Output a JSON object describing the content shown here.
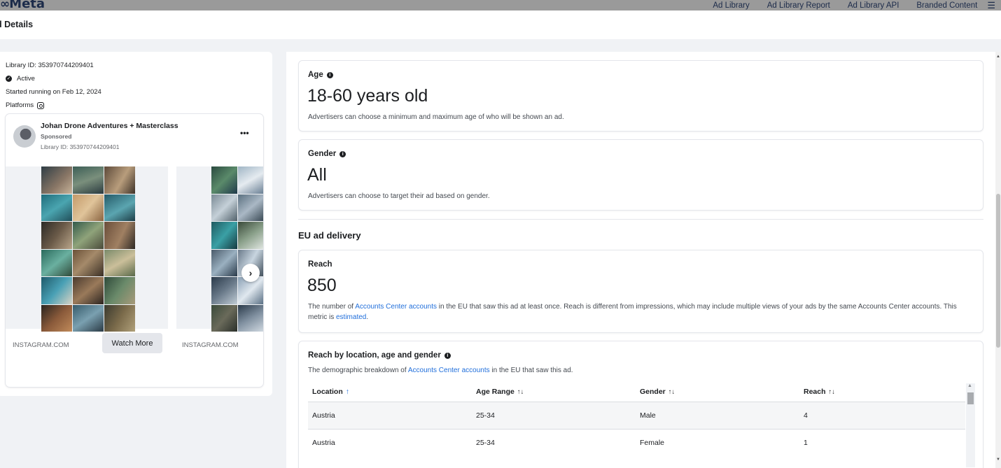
{
  "nav": {
    "logo_mark": "∞",
    "logo_text": "Meta",
    "links": [
      "Ad Library",
      "Ad Library Report",
      "Ad Library API",
      "Branded Content"
    ],
    "menu_icon": "☰"
  },
  "header": {
    "title": "d Details"
  },
  "ad_meta": {
    "library_id": "Library ID: 353970744209401",
    "status": "Active",
    "started": "Started running on Feb 12, 2024",
    "platforms_label": "Platforms",
    "platform_icon": "instagram-icon"
  },
  "ad_preview": {
    "advertiser": "Johan Drone Adventures + Masterclass",
    "sponsored": "Sponsored",
    "library_id": "Library ID: 353970744209401",
    "more": "•••",
    "next": "›",
    "cards": [
      {
        "domain": "INSTAGRAM.COM",
        "cta": "Watch More"
      },
      {
        "domain": "INSTAGRAM.COM"
      }
    ]
  },
  "age": {
    "label": "Age",
    "value": "18-60 years old",
    "description": "Advertisers can choose a minimum and maximum age of who will be shown an ad."
  },
  "gender": {
    "label": "Gender",
    "value": "All",
    "description": "Advertisers can choose to target their ad based on gender."
  },
  "eu_delivery": {
    "title": "EU ad delivery",
    "reach": {
      "label": "Reach",
      "value": "850",
      "desc_pre": "The number of ",
      "desc_link": "Accounts Center accounts",
      "desc_mid": " in the EU that saw this ad at least once. Reach is different from impressions, which may include multiple views of your ads by the same Accounts Center accounts. This metric is ",
      "desc_link2": "estimated",
      "desc_post": "."
    },
    "breakdown": {
      "label": "Reach by location, age and gender",
      "desc_pre": "The demographic breakdown of ",
      "desc_link": "Accounts Center accounts",
      "desc_post": " in the EU that saw this ad.",
      "columns": [
        {
          "label": "Location",
          "sort": "↑"
        },
        {
          "label": "Age Range",
          "sort": "↑↓"
        },
        {
          "label": "Gender",
          "sort": "↑↓"
        },
        {
          "label": "Reach",
          "sort": "↑↓"
        }
      ],
      "rows": [
        {
          "location": "Austria",
          "age": "25-34",
          "gender": "Male",
          "reach": "4"
        },
        {
          "location": "Austria",
          "age": "25-34",
          "gender": "Female",
          "reach": "1"
        }
      ]
    }
  },
  "colors": {
    "link": "#216fdb",
    "topbar": "#9a9a9a",
    "text": "#1c1e21"
  }
}
